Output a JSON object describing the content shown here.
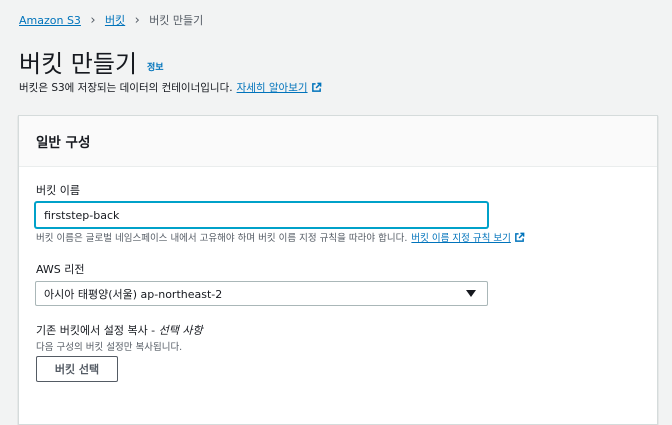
{
  "breadcrumb": {
    "items": [
      {
        "label": "Amazon S3"
      },
      {
        "label": "버킷"
      },
      {
        "label": "버킷 만들기"
      }
    ]
  },
  "header": {
    "title": "버킷 만들기",
    "info_label": "정보",
    "description": "버킷은 S3에 저장되는 데이터의 컨테이너입니다.",
    "learn_more_label": "자세히 알아보기"
  },
  "general_config": {
    "title": "일반 구성",
    "bucket_name": {
      "label": "버킷 이름",
      "value": "firststep-back",
      "hint": "버킷 이름은 글로벌 네임스페이스 내에서 고유해야 하며 버킷 이름 지정 규칙을 따라야 합니다.",
      "rules_link": "버킷 이름 지정 규칙 보기"
    },
    "region": {
      "label": "AWS 리전",
      "selected": "아시아 태평양(서울) ap-northeast-2"
    },
    "copy_settings": {
      "label": "기존 버킷에서 설정 복사 - ",
      "optional": "선택 사항",
      "hint": "다음 구성의 버킷 설정만 복사됩니다.",
      "button_label": "버킷 선택"
    }
  },
  "colors": {
    "link": "#0073bb",
    "focus": "#00a1c9",
    "background": "#f2f3f3"
  },
  "icons": {
    "external_link": "external-link-icon",
    "dropdown": "caret-down-icon"
  }
}
